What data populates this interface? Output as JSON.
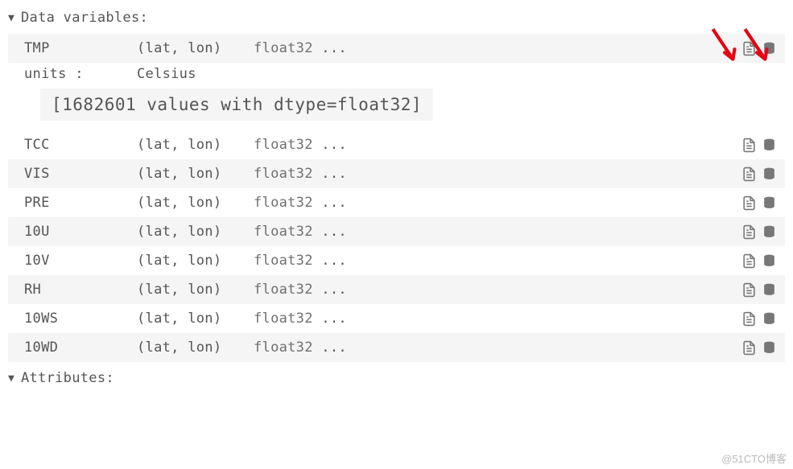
{
  "sections": {
    "datavars_label": "Data variables:",
    "attributes_label": "Attributes:"
  },
  "expanded": {
    "attr_key": "units :",
    "attr_val": "Celsius",
    "repr": "[1682601 values with dtype=float32]"
  },
  "vars": [
    {
      "name": "TMP",
      "dims": "(lat, lon)",
      "dtype": "float32",
      "dots": " ...",
      "shaded": true,
      "expanded": true
    },
    {
      "name": "TCC",
      "dims": "(lat, lon)",
      "dtype": "float32",
      "dots": " ...",
      "shaded": false,
      "expanded": false
    },
    {
      "name": "VIS",
      "dims": "(lat, lon)",
      "dtype": "float32",
      "dots": " ...",
      "shaded": true,
      "expanded": false
    },
    {
      "name": "PRE",
      "dims": "(lat, lon)",
      "dtype": "float32",
      "dots": " ...",
      "shaded": false,
      "expanded": false
    },
    {
      "name": "10U",
      "dims": "(lat, lon)",
      "dtype": "float32",
      "dots": " ...",
      "shaded": true,
      "expanded": false
    },
    {
      "name": "10V",
      "dims": "(lat, lon)",
      "dtype": "float32",
      "dots": " ...",
      "shaded": false,
      "expanded": false
    },
    {
      "name": "RH",
      "dims": "(lat, lon)",
      "dtype": "float32",
      "dots": " ...",
      "shaded": true,
      "expanded": false
    },
    {
      "name": "10WS",
      "dims": "(lat, lon)",
      "dtype": "float32",
      "dots": " ...",
      "shaded": false,
      "expanded": false
    },
    {
      "name": "10WD",
      "dims": "(lat, lon)",
      "dtype": "float32",
      "dots": " ...",
      "shaded": true,
      "expanded": false
    }
  ],
  "watermark": "@51CTO博客"
}
